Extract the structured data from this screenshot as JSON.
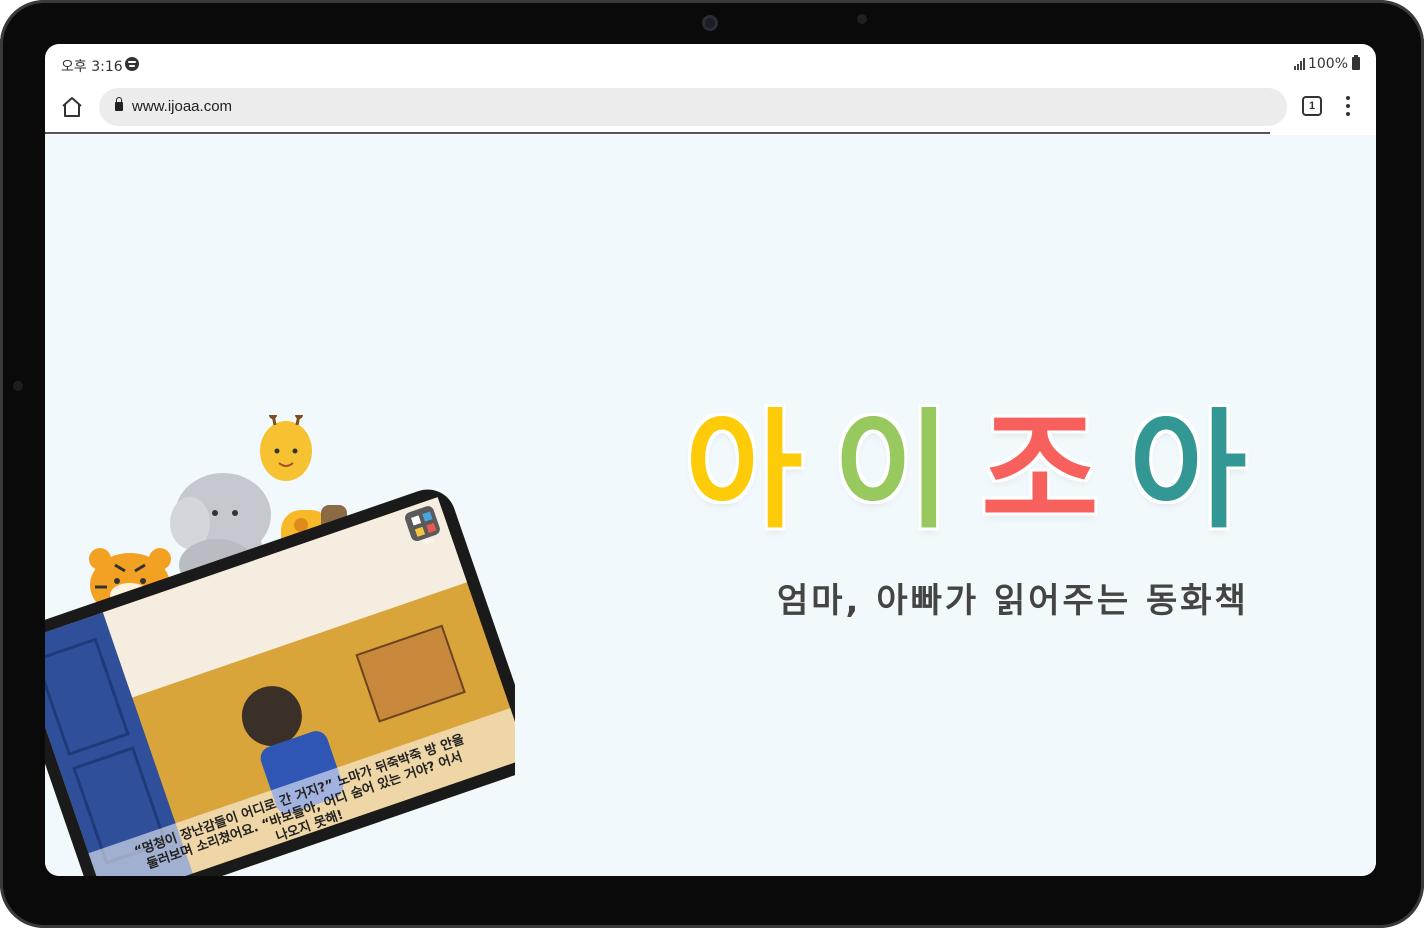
{
  "status_bar": {
    "time": "오후 3:16",
    "battery": "100%"
  },
  "browser": {
    "url": "www.ijoaa.com",
    "tab_count": "1",
    "load_progress": 0.92
  },
  "hero": {
    "logo_letters": [
      {
        "char": "아",
        "color": "#fdcb07"
      },
      {
        "char": "이",
        "color": "#98c95e"
      },
      {
        "char": "조",
        "color": "#f8605d"
      },
      {
        "char": "아",
        "color": "#339893"
      }
    ],
    "tagline": "엄마, 아빠가 읽어주는 동화책"
  },
  "illustration": {
    "caption_line1": "“멍청이 장난감들이 어디로 간 거지?” 노마가 뒤죽박죽 방 안을",
    "caption_line2": "둘러보며 소리쳤어요. “바보들아, 어디 숨어 있는 거야? 어서",
    "caption_line3": "나오지 못해!",
    "app_icon_label": "메뉴"
  },
  "colors": {
    "page_bg": "#f2f9fc",
    "tagline": "#444444"
  }
}
